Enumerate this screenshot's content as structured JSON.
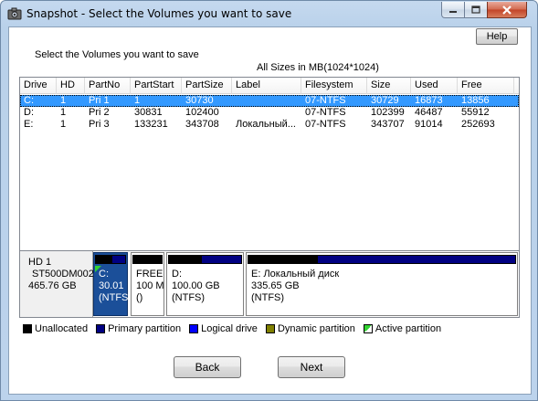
{
  "window": {
    "title": "Snapshot - Select the Volumes you want to save"
  },
  "help_label": "Help",
  "instruction": "Select the Volumes you want to save",
  "sizes_note": "All Sizes in MB(1024*1024)",
  "volumes_table": {
    "columns": [
      "Drive",
      "HD",
      "PartNo",
      "PartStart",
      "PartSize",
      "Label",
      "Filesystem",
      "Size",
      "Used",
      "Free"
    ],
    "rows": [
      [
        "C:",
        "1",
        "Pri  1",
        "1",
        "30730",
        "",
        "07-NTFS",
        "30729",
        "16873",
        "13856"
      ],
      [
        "D:",
        "1",
        "Pri  2",
        "30831",
        "102400",
        "",
        "07-NTFS",
        "102399",
        "46487",
        "55912"
      ],
      [
        "E:",
        "1",
        "Pri  3",
        "133231",
        "343708",
        "Локальный...",
        "07-NTFS",
        "343707",
        "91014",
        "252693"
      ]
    ],
    "selected_row": 0
  },
  "disk": {
    "name": "HD 1",
    "model": "ST500DM002",
    "size": "465.76 GB",
    "partitions": [
      {
        "line1": "C:",
        "line2": "30.01",
        "line3": "(NTFS",
        "used_fraction": 0.55,
        "selected": true,
        "active": true
      },
      {
        "line1": "FREE",
        "line2": "100 M",
        "line3": "()",
        "used_fraction": 1.0,
        "selected": false,
        "active": false,
        "unallocated": true
      },
      {
        "line1": "D:",
        "line2": "100.00 GB",
        "line3": "(NTFS)",
        "used_fraction": 0.45,
        "selected": false,
        "active": false
      },
      {
        "line1": "E: Локальный диск",
        "line2": "335.65 GB",
        "line3": "(NTFS)",
        "used_fraction": 0.26,
        "selected": false,
        "active": false
      }
    ]
  },
  "legend": [
    {
      "label": "Unallocated",
      "color": "#000000"
    },
    {
      "label": "Primary partition",
      "color": "#000082"
    },
    {
      "label": "Logical drive",
      "color": "#0000ff"
    },
    {
      "label": "Dynamic partition",
      "color": "#808000"
    },
    {
      "label": "Active partition",
      "color": "#32d332"
    }
  ],
  "buttons": {
    "back": "Back",
    "next": "Next"
  }
}
